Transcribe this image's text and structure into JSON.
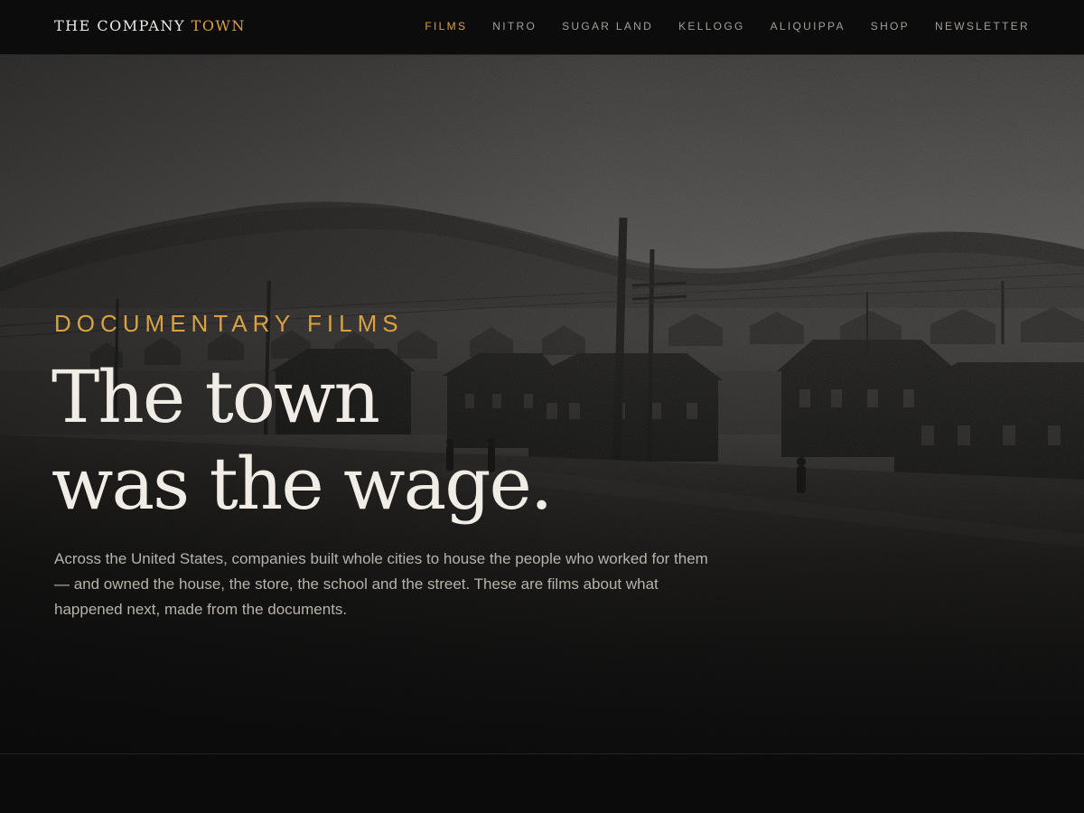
{
  "brand": {
    "name": "THE COMPANY",
    "accent": "TOWN"
  },
  "nav": {
    "items": [
      {
        "label": "FILMS",
        "active": true
      },
      {
        "label": "NITRO",
        "active": false
      },
      {
        "label": "SUGAR LAND",
        "active": false
      },
      {
        "label": "KELLOGG",
        "active": false
      },
      {
        "label": "ALIQUIPPA",
        "active": false
      },
      {
        "label": "SHOP",
        "active": false
      },
      {
        "label": "NEWSLETTER",
        "active": false
      }
    ]
  },
  "hero": {
    "eyebrow": "DOCUMENTARY FILMS",
    "headline_line1": "The town",
    "headline_line2": "was the wage.",
    "lede": "Across the United States, companies built whole cities to house the people who worked for them — and owned the house, the store, the school and the street. These are films about what happened next, made from the documents.",
    "image": "archival-photo-company-town"
  },
  "colors": {
    "accent": "#d9a142",
    "background": "#0c0b0b",
    "text": "#f1ede6",
    "muted": "#b7b2aa"
  }
}
